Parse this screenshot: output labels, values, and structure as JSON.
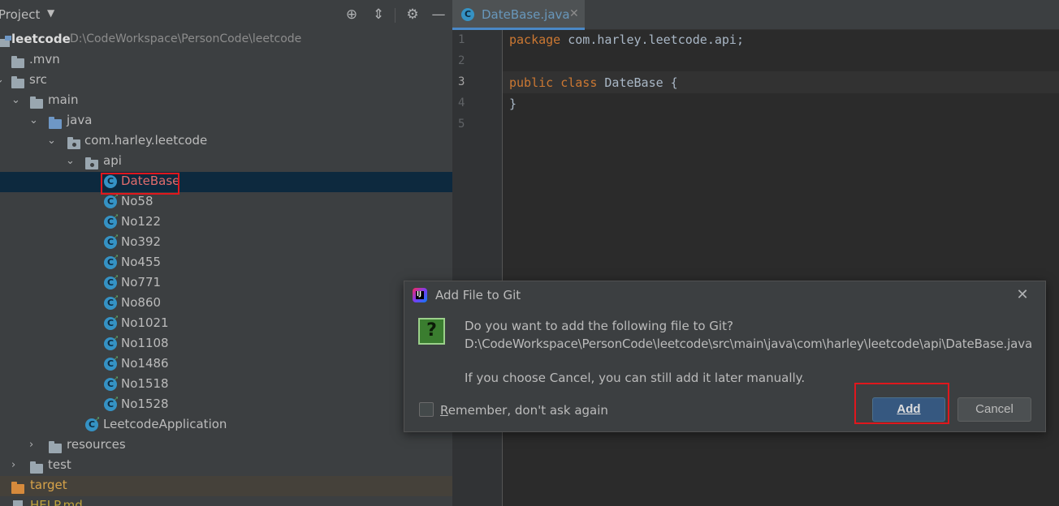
{
  "project_panel": {
    "title": "Project",
    "header_icons": [
      "crosshair-icon",
      "collapse-all-icon",
      "gear-icon",
      "minimize-icon"
    ],
    "tree": [
      {
        "label": "leetcode",
        "path": "D:\\CodeWorkspace\\PersonCode\\leetcode",
        "kind": "module"
      },
      {
        "label": ".mvn",
        "kind": "folder"
      },
      {
        "label": "src",
        "kind": "folder"
      },
      {
        "label": "main",
        "kind": "folder"
      },
      {
        "label": "java",
        "kind": "source-folder"
      },
      {
        "label": "com.harley.leetcode",
        "kind": "package"
      },
      {
        "label": "api",
        "kind": "package"
      },
      {
        "label": "DateBase",
        "kind": "class",
        "selected": true
      },
      {
        "label": "No58",
        "kind": "class"
      },
      {
        "label": "No122",
        "kind": "class"
      },
      {
        "label": "No392",
        "kind": "class"
      },
      {
        "label": "No455",
        "kind": "class"
      },
      {
        "label": "No771",
        "kind": "class"
      },
      {
        "label": "No860",
        "kind": "class"
      },
      {
        "label": "No1021",
        "kind": "class"
      },
      {
        "label": "No1108",
        "kind": "class"
      },
      {
        "label": "No1486",
        "kind": "class"
      },
      {
        "label": "No1518",
        "kind": "class"
      },
      {
        "label": "No1528",
        "kind": "class"
      },
      {
        "label": "LeetcodeApplication",
        "kind": "app-class"
      },
      {
        "label": "resources",
        "kind": "resources-folder"
      },
      {
        "label": "test",
        "kind": "folder"
      },
      {
        "label": "target",
        "kind": "excluded-folder"
      },
      {
        "label": "HELP.md",
        "kind": "file"
      }
    ]
  },
  "editor": {
    "tab": {
      "label": "DateBase.java",
      "close": "✕"
    },
    "line_numbers": [
      "1",
      "2",
      "3",
      "4",
      "5"
    ],
    "code": {
      "line1_kw": "package",
      "line1_rest": " com.harley.leetcode.api;",
      "line3_kw1": "public",
      "line3_kw2": "class",
      "line3_rest": " DateBase {",
      "line4": "}"
    }
  },
  "dialog": {
    "title": "Add File to Git",
    "question_mark": "?",
    "message_line1": "Do you want to add the following file to Git?",
    "message_line2": "D:\\CodeWorkspace\\PersonCode\\leetcode\\src\\main\\java\\com\\harley\\leetcode\\api\\DateBase.java",
    "message_line3": "If you choose Cancel, you can still add it later manually.",
    "remember_label_mnemonic": "R",
    "remember_label_rest": "emember, don't ask again",
    "remember_checked": false,
    "add_label": "Add",
    "cancel_label": "Cancel",
    "close": "✕"
  },
  "colors": {
    "highlight": "#e0171d",
    "selection": "#0d293e",
    "keyword": "#cc7832",
    "tab_label": "#6897bb"
  }
}
